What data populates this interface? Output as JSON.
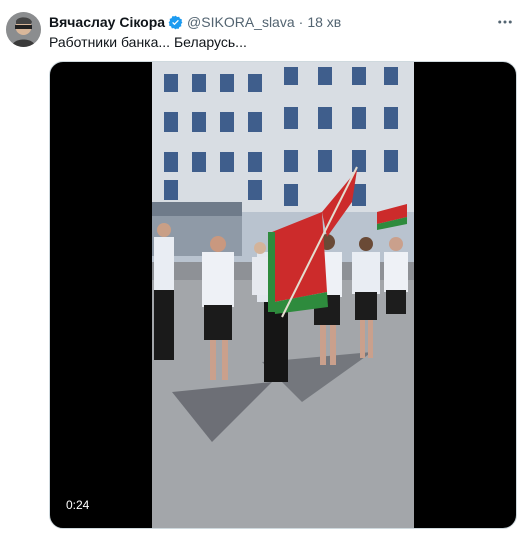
{
  "tweet": {
    "author_name": "Вячаслау Сікора",
    "handle": "@SIKORA_slava",
    "separator": "·",
    "time": "18 хв",
    "text": "Работники банка... Беларусь...",
    "verified": true
  },
  "video": {
    "duration": "0:24"
  },
  "icons": {
    "verified": "verified-badge-icon",
    "more": "more-options-icon"
  },
  "colors": {
    "verified_blue": "#1d9bf0",
    "secondary_text": "#536471",
    "flag_red": "#cc2b2b",
    "flag_green": "#2e8b3d"
  }
}
